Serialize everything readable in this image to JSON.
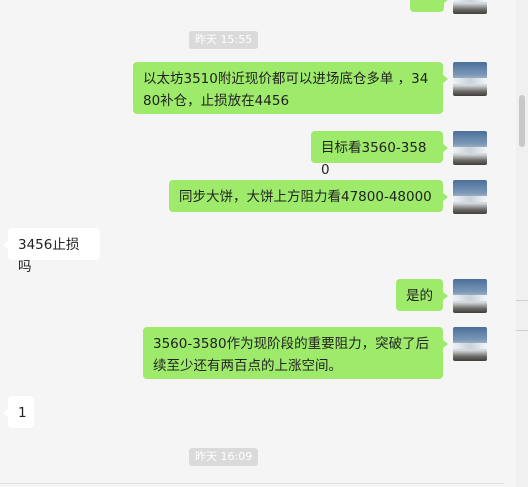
{
  "timestamps": [
    "昨天 15:55",
    "昨天 16:09"
  ],
  "messages": [
    {
      "dir": "out",
      "text": ""
    },
    {
      "dir": "out",
      "text": "以太坊3510附近现价都可以进场底仓多单 ，3480补仓，止损放在4456"
    },
    {
      "dir": "out",
      "text": "目标看3560-3580"
    },
    {
      "dir": "out",
      "text": "同步大饼，大饼上方阻力看47800-48000"
    },
    {
      "dir": "in",
      "text": "3456止损吗"
    },
    {
      "dir": "out",
      "text": "是的"
    },
    {
      "dir": "out",
      "text": "3560-3580作为现阶段的重要阻力，突破了后续至少还有两百点的上涨空间。"
    },
    {
      "dir": "in",
      "text": "1"
    }
  ],
  "colors": {
    "outgoing_bubble": "#9eea6a",
    "incoming_bubble": "#ffffff",
    "background": "#f5f5f5",
    "time_badge": "#dadada"
  },
  "icons": {
    "avatar": "avatar-sea-photo"
  }
}
